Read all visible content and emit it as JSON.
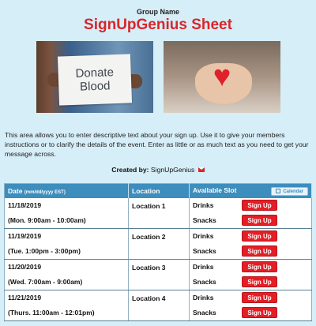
{
  "header": {
    "group_name": "Group Name",
    "title": "SignUpGenius Sheet"
  },
  "images": {
    "left": {
      "card_line1": "Donate",
      "card_line2": "Blood"
    },
    "right": {
      "icon": "heart-icon"
    }
  },
  "description": "This area allows you to enter descriptive text about your sign up. Use it to give your members instructions or to clarify the details of the event. Enter as little or as much text as you need to get your message across.",
  "created_by": {
    "label": "Created by:",
    "name": "SignUpGenius"
  },
  "table": {
    "headers": {
      "date": "Date",
      "date_format": "(mm/dd/yyyy EST)",
      "location": "Location",
      "slot": "Available Slot",
      "calendar": "Calendar"
    },
    "rows": [
      {
        "date": "11/18/2019",
        "time": "(Mon. 9:00am - 10:00am)",
        "location": "Location 1",
        "slots": [
          {
            "name": "Drinks",
            "button": "Sign Up"
          },
          {
            "name": "Snacks",
            "button": "Sign Up"
          }
        ]
      },
      {
        "date": "11/19/2019",
        "time": "(Tue. 1:00pm - 3:00pm)",
        "location": "Location 2",
        "slots": [
          {
            "name": "Drinks",
            "button": "Sign Up"
          },
          {
            "name": "Snacks",
            "button": "Sign Up"
          }
        ]
      },
      {
        "date": "11/20/2019",
        "time": "(Wed. 7:00am - 9:00am)",
        "location": "Location 3",
        "slots": [
          {
            "name": "Drinks",
            "button": "Sign Up"
          },
          {
            "name": "Snacks",
            "button": "Sign Up"
          }
        ]
      },
      {
        "date": "11/21/2019",
        "time": "(Thurs. 11:00am - 12:01pm)",
        "location": "Location 4",
        "slots": [
          {
            "name": "Drinks",
            "button": "Sign Up"
          },
          {
            "name": "Snacks",
            "button": "Sign Up"
          }
        ]
      }
    ]
  },
  "colors": {
    "accent": "#d9262a",
    "header_bg": "#3d8dbd",
    "page_bg": "#d6eef8",
    "button": "#e41e26"
  }
}
